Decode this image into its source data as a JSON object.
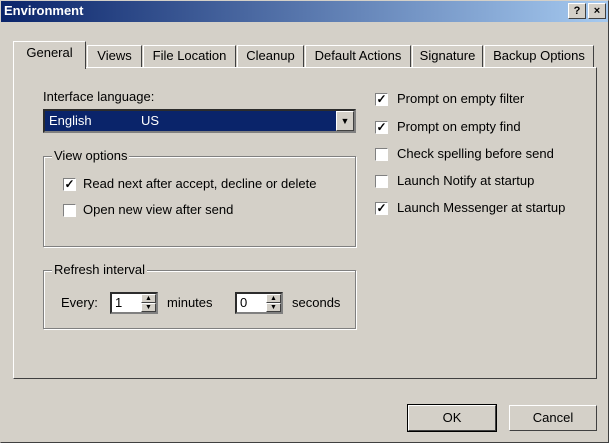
{
  "window": {
    "title": "Environment",
    "help": "?",
    "close": "×"
  },
  "tabs": [
    {
      "label": "General",
      "active": true
    },
    {
      "label": "Views"
    },
    {
      "label": "File Location"
    },
    {
      "label": "Cleanup"
    },
    {
      "label": "Default Actions"
    },
    {
      "label": "Signature"
    },
    {
      "label": "Backup Options"
    }
  ],
  "language": {
    "label": "Interface language:",
    "value": "English",
    "region": "US"
  },
  "view_options": {
    "title": "View options",
    "items": [
      {
        "label": "Read next after accept, decline or delete",
        "checked": true
      },
      {
        "label": "Open new view after send",
        "checked": false
      }
    ]
  },
  "refresh": {
    "title": "Refresh interval",
    "every": "Every:",
    "minutes_value": "1",
    "minutes_label": "minutes",
    "seconds_value": "0",
    "seconds_label": "seconds"
  },
  "right_options": [
    {
      "label": "Prompt on empty filter",
      "checked": true
    },
    {
      "label": "Prompt on empty find",
      "checked": true
    },
    {
      "label": "Check spelling before send",
      "checked": false
    },
    {
      "label": "Launch Notify at startup",
      "checked": false
    },
    {
      "label": "Launch Messenger at startup",
      "checked": true
    }
  ],
  "buttons": {
    "ok": "OK",
    "cancel": "Cancel"
  },
  "colors": {
    "titlebar": "#0a246a",
    "face": "#d4d0c8",
    "selection": "#0a246a"
  }
}
